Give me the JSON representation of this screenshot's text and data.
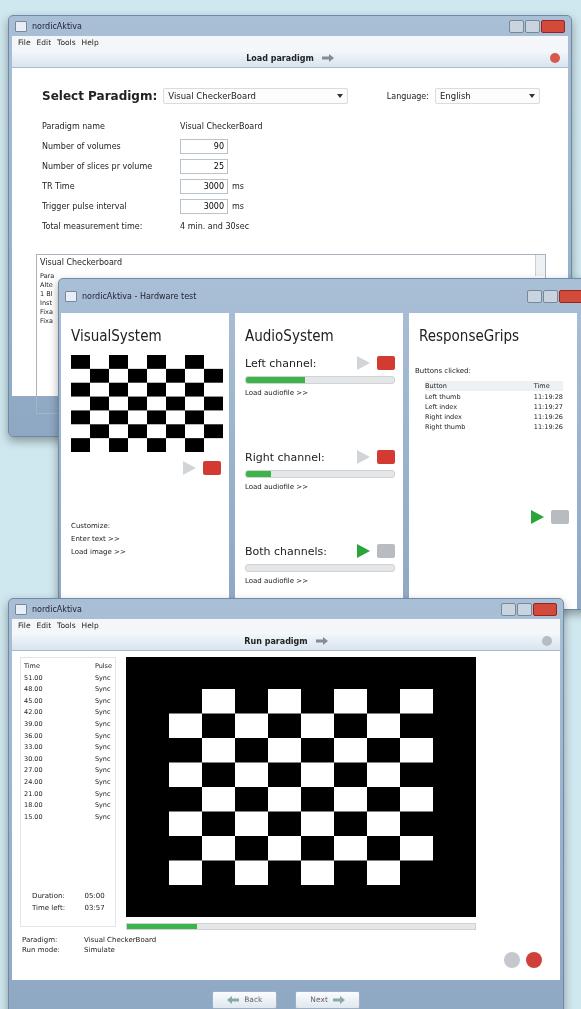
{
  "setup_window": {
    "title": "nordicAktiva",
    "menu": [
      "File",
      "Edit",
      "Tools",
      "Help"
    ],
    "step": "Load paradigm",
    "paradigm_select": {
      "label": "Select Paradigm:",
      "value": "Visual CheckerBoard"
    },
    "language_select": {
      "label": "Language:",
      "value": "English"
    },
    "fields": [
      {
        "kind": "text",
        "label": "Paradigm name",
        "value": "Visual CheckerBoard"
      },
      {
        "kind": "input",
        "label": "Number of volumes",
        "value": "90"
      },
      {
        "kind": "input",
        "label": "Number of slices pr volume",
        "value": "25"
      },
      {
        "kind": "input",
        "label": "TR Time",
        "value": "3000",
        "unit": "ms"
      },
      {
        "kind": "input",
        "label": "Trigger pulse interval",
        "value": "3000",
        "unit": "ms"
      },
      {
        "kind": "text",
        "label": "Total measurement time:",
        "value": "4 min. and 30sec"
      }
    ],
    "description": {
      "title": "Visual Checkerboard",
      "lines": [
        "Para",
        "Alte",
        "1 Bl",
        "Inst",
        "Fixa",
        "Fixa"
      ]
    }
  },
  "hardware_window": {
    "title": "nordicAktiva - Hardware test",
    "visual": {
      "heading": "VisualSystem",
      "play_enabled": false,
      "stop_enabled": true,
      "customize_label": "Customize:",
      "links": [
        "Enter text >>",
        "Load image >>"
      ]
    },
    "audio": {
      "heading": "AudioSystem",
      "channels": [
        {
          "label": "Left channel:",
          "play_enabled": false,
          "stop_enabled": true,
          "level": 0.4,
          "link": "Load audiofile >>"
        },
        {
          "label": "Right channel:",
          "play_enabled": false,
          "stop_enabled": true,
          "level": 0.17,
          "link": "Load audiofile >>"
        },
        {
          "label": "Both channels:",
          "play_enabled": true,
          "stop_enabled": false,
          "level": 0,
          "link": "Load audiofile >>"
        }
      ]
    },
    "grips": {
      "heading": "ResponseGrips",
      "caption": "Buttons clicked:",
      "columns": [
        "Button",
        "Time"
      ],
      "rows": [
        [
          "Left thumb",
          "11:19:28"
        ],
        [
          "Left index",
          "11:19:27"
        ],
        [
          "Right index",
          "11:19:26"
        ],
        [
          "Right thumb",
          "11:19:26"
        ]
      ],
      "play_enabled": true,
      "stop_enabled": false
    }
  },
  "run_window": {
    "title": "nordicAktiva",
    "menu": [
      "File",
      "Edit",
      "Tools",
      "Help"
    ],
    "step": "Run paradigm",
    "log": {
      "columns": [
        "Time",
        "Pulse"
      ],
      "rows": [
        [
          "51.00",
          "Sync"
        ],
        [
          "48.00",
          "Sync"
        ],
        [
          "45.00",
          "Sync"
        ],
        [
          "42.00",
          "Sync"
        ],
        [
          "39.00",
          "Sync"
        ],
        [
          "36.00",
          "Sync"
        ],
        [
          "33.00",
          "Sync"
        ],
        [
          "30.00",
          "Sync"
        ],
        [
          "27.00",
          "Sync"
        ],
        [
          "24.00",
          "Sync"
        ],
        [
          "21.00",
          "Sync"
        ],
        [
          "18.00",
          "Sync"
        ],
        [
          "15.00",
          "Sync"
        ]
      ]
    },
    "summary": [
      {
        "label": "Duration:",
        "value": "05:00"
      },
      {
        "label": "Time left:",
        "value": "03:57"
      }
    ],
    "progress": {
      "level": 0.2
    },
    "info": [
      {
        "label": "Paradigm:",
        "value": "Visual CheckerBoard"
      },
      {
        "label": "Run mode:",
        "value": "Simulate"
      }
    ],
    "buttons": [
      "Back",
      "Next"
    ]
  }
}
